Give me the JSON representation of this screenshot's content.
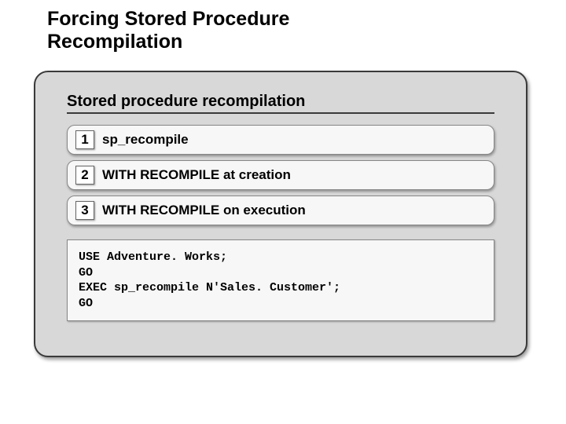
{
  "title_line1": "Forcing Stored Procedure",
  "title_line2": "Recompilation",
  "section_heading": "Stored procedure recompilation",
  "items": [
    {
      "num": "1",
      "label": "sp_recompile"
    },
    {
      "num": "2",
      "label": "WITH RECOMPILE at creation"
    },
    {
      "num": "3",
      "label": "WITH RECOMPILE on execution"
    }
  ],
  "code": "USE Adventure. Works;\nGO\nEXEC sp_recompile N'Sales. Customer';\nGO"
}
